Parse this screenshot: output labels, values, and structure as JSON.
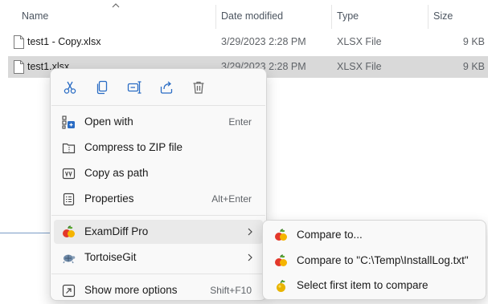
{
  "columns": {
    "name": "Name",
    "date_modified": "Date modified",
    "type": "Type",
    "size": "Size"
  },
  "files": [
    {
      "name": "test1 - Copy.xlsx",
      "date": "3/29/2023 2:28 PM",
      "type": "XLSX File",
      "size": "9 KB",
      "selected": false
    },
    {
      "name": "test1.xlsx",
      "date": "3/29/2023 2:28 PM",
      "type": "XLSX File",
      "size": "9 KB",
      "selected": true
    }
  ],
  "context_menu": {
    "quick_actions": [
      "cut-icon",
      "copy-icon",
      "rename-icon",
      "share-icon",
      "delete-icon"
    ],
    "items": [
      {
        "label": "Open with",
        "shortcut": "Enter",
        "icon": "open-with-icon"
      },
      {
        "label": "Compress to ZIP file",
        "shortcut": "",
        "icon": "zip-icon"
      },
      {
        "label": "Copy as path",
        "shortcut": "",
        "icon": "copy-path-icon"
      },
      {
        "label": "Properties",
        "shortcut": "Alt+Enter",
        "icon": "properties-icon"
      },
      {
        "label": "ExamDiff Pro",
        "shortcut": "",
        "icon": "examdiff-icon",
        "submenu": true
      },
      {
        "label": "TortoiseGit",
        "shortcut": "",
        "icon": "tortoisegit-icon",
        "submenu": true
      },
      {
        "label": "Show more options",
        "shortcut": "Shift+F10",
        "icon": "more-options-icon"
      }
    ]
  },
  "submenu": {
    "items": [
      {
        "label": "Compare to...",
        "icon": "examdiff-icon"
      },
      {
        "label": "Compare to \"C:\\Temp\\InstallLog.txt\"",
        "icon": "examdiff-icon"
      },
      {
        "label": "Select first item to compare",
        "icon": "apple-icon"
      }
    ]
  },
  "colors": {
    "accent": "#2a6cc4",
    "selection": "#d9d9d9",
    "menu_bg": "#f9f9f9",
    "hover": "#eaeaea"
  }
}
